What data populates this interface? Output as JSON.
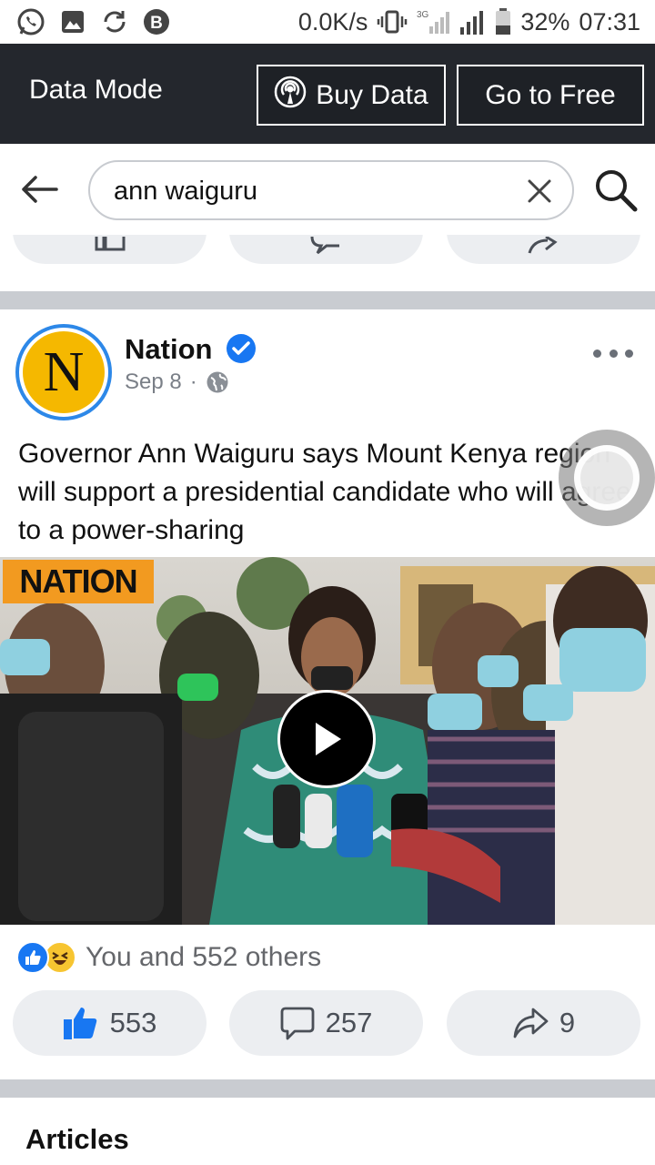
{
  "status_bar": {
    "icons_left": [
      "whatsapp-icon",
      "gallery-icon",
      "sync-icon",
      "b-app-icon"
    ],
    "speed": "0.0K/s",
    "net": "3G",
    "battery": "32%",
    "time": "07:31"
  },
  "data_mode": {
    "title": "Data Mode",
    "buy_label": "Buy Data",
    "free_label": "Go to Free"
  },
  "search": {
    "query": "ann waiguru"
  },
  "post": {
    "page_name": "Nation",
    "avatar_letter": "N",
    "date": "Sep 8",
    "separator": "·",
    "text": "Governor Ann Waiguru says Mount Kenya region will support a presidential candidate who will agree to a power-sharing",
    "video_badge": "NATION",
    "reactions_text": "You and 552 others",
    "like_count": "553",
    "comment_count": "257",
    "share_count": "9"
  },
  "articles": {
    "title": "Articles"
  },
  "colors": {
    "top_bar": "#24272d",
    "facebook_blue": "#1877f2",
    "pill_bg": "#eceef1",
    "badge_orange": "#f29a20"
  }
}
